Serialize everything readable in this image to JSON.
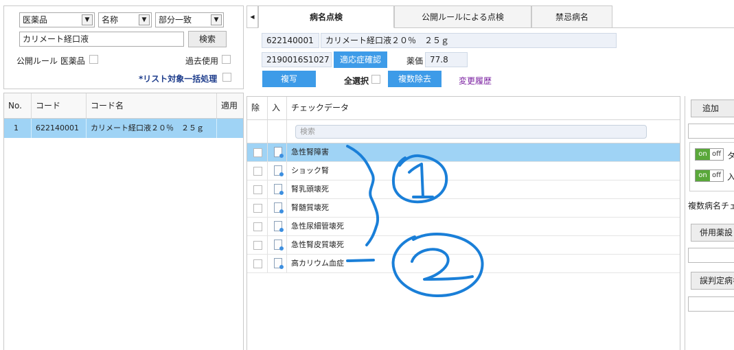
{
  "search": {
    "category": "医薬品",
    "field": "名称",
    "match_mode": "部分一致",
    "query": "カリメート経口液",
    "search_button": "検索",
    "public_rule_label": "公開ルール 医薬品",
    "past_use_label": "過去使用",
    "bulk_label": "*リスト対象一括処理"
  },
  "result_table": {
    "headers": [
      "No.",
      "コード",
      "コード名",
      "適用"
    ],
    "rows": [
      {
        "no": "1",
        "code": "622140001",
        "name": "カリメート経口液２０％　２５ｇ",
        "extra": ""
      }
    ]
  },
  "tabs": [
    {
      "label": "病名点検",
      "active": true
    },
    {
      "label": "公開ルールによる点検",
      "active": false
    },
    {
      "label": "禁忌病名",
      "active": false
    }
  ],
  "detail": {
    "code": "622140001",
    "drug_name": "カリメート経口液２０％　２５ｇ",
    "yj_code": "2190016S1027",
    "indication_button": "適応症確認",
    "price_label": "薬価",
    "price_value": "77.8",
    "copy_button": "複写",
    "select_all_label": "全選択",
    "multi_remove_button": "複数除去",
    "history_link": "変更履歴"
  },
  "check_table": {
    "headers": [
      "除",
      "入",
      "チェックデータ"
    ],
    "filter_placeholder": "検索",
    "rows": [
      {
        "name": "急性腎障害",
        "selected": true
      },
      {
        "name": "ショック腎",
        "selected": false
      },
      {
        "name": "腎乳頭壊死",
        "selected": false
      },
      {
        "name": "腎髄質壊死",
        "selected": false
      },
      {
        "name": "急性尿細管壊死",
        "selected": false
      },
      {
        "name": "急性腎皮質壊死",
        "selected": false
      },
      {
        "name": "高カリウム血症",
        "selected": false
      }
    ]
  },
  "side_panel": {
    "add_button": "追加",
    "toggle_on": "on",
    "toggle_off": "off",
    "toggle1_label": "タ",
    "toggle2_label": "入",
    "multi_disease_label": "複数病名チェ",
    "combined_drug_button": "併用薬設",
    "misjudge_button": "誤判定病名"
  },
  "annotations": {
    "color": "#1a7fd8",
    "marks": [
      "1",
      "2"
    ]
  },
  "colors": {
    "selection_blue": "#9fd3f5",
    "button_blue": "#3d9be8",
    "field_bg": "#edf1f8",
    "link_purple": "#7a1fa0",
    "toggle_green": "#5aa83a"
  }
}
